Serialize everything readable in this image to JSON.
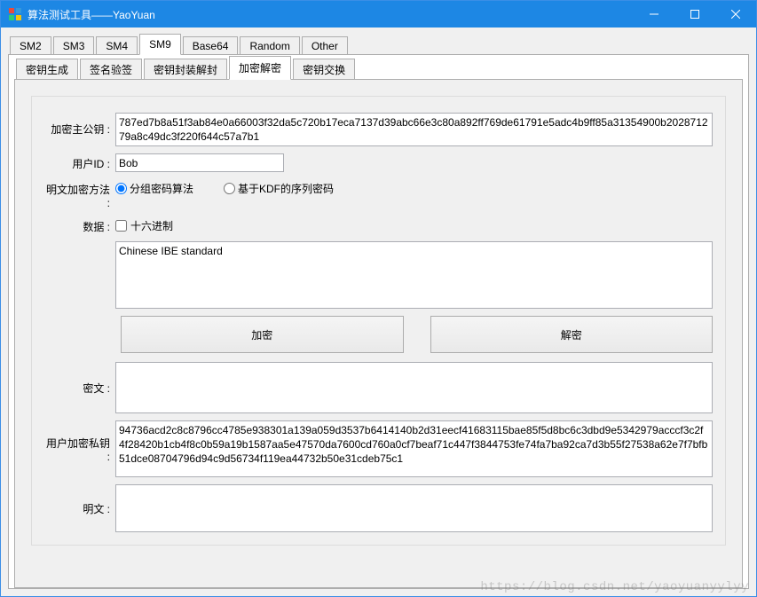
{
  "window": {
    "title": "算法测试工具——YaoYuan"
  },
  "top_tabs": [
    "SM2",
    "SM3",
    "SM4",
    "SM9",
    "Base64",
    "Random",
    "Other"
  ],
  "top_tab_active_index": 3,
  "sub_tabs": [
    "密钥生成",
    "签名验签",
    "密钥封装解封",
    "加密解密",
    "密钥交换"
  ],
  "sub_tab_active_index": 3,
  "labels": {
    "enc_master_pub": "加密主公钥 :",
    "user_id": "用户ID :",
    "plain_method": "明文加密方法 :",
    "data": "数据 :",
    "ciphertext": "密文 :",
    "user_enc_priv": "用户加密私钥 :",
    "plaintext": "明文 :"
  },
  "radio": {
    "block_cipher": "分组密码算法",
    "kdf_stream": "基于KDF的序列密码",
    "selected": "block_cipher"
  },
  "checkbox": {
    "hex_label": "十六进制",
    "hex_checked": false
  },
  "buttons": {
    "encrypt": "加密",
    "decrypt": "解密"
  },
  "values": {
    "enc_master_pub": "787ed7b8a51f3ab84e0a66003f32da5c720b17eca7137d39abc66e3c80a892ff769de61791e5adc4b9ff85a31354900b202871279a8c49dc3f220f644c57a7b1",
    "user_id": "Bob",
    "data_input": "Chinese IBE standard",
    "ciphertext": "",
    "user_enc_priv": "94736acd2c8c8796cc4785e938301a139a059d3537b6414140b2d31eecf41683115bae85f5d8bc6c3dbd9e5342979acccf3c2f4f28420b1cb4f8c0b59a19b1587aa5e47570da7600cd760a0cf7beaf71c447f3844753fe74fa7ba92ca7d3b55f27538a62e7f7bfb51dce08704796d94c9d56734f119ea44732b50e31cdeb75c1",
    "plaintext": ""
  },
  "watermark": "https://blog.csdn.net/yaoyuanyylyy"
}
